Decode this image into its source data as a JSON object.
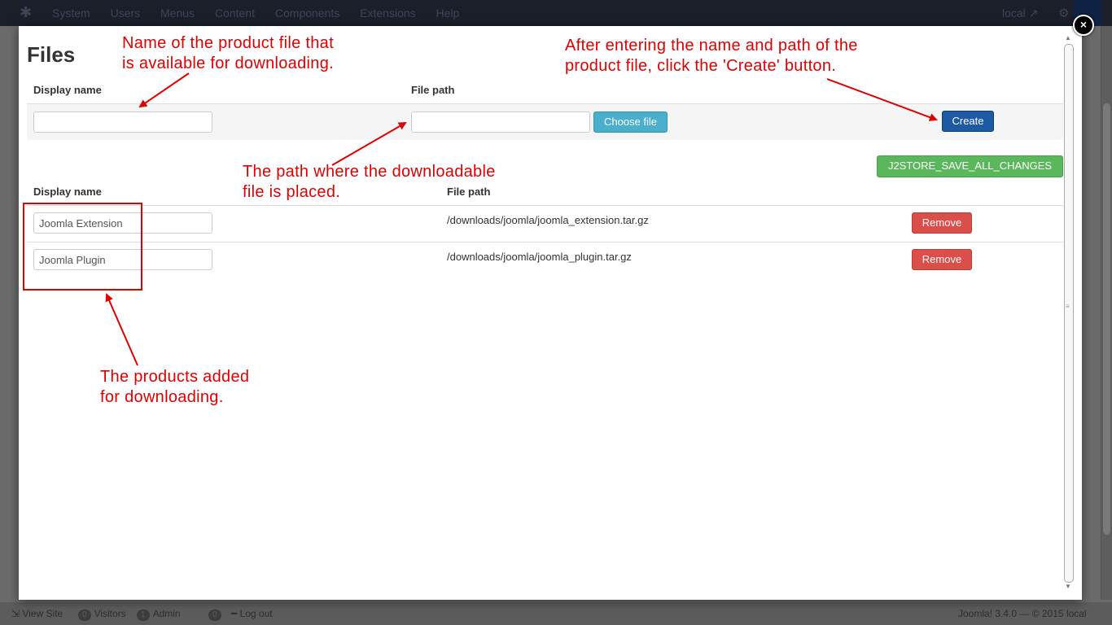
{
  "topbar": {
    "menu": [
      "System",
      "Users",
      "Menus",
      "Content",
      "Components",
      "Extensions",
      "Help"
    ],
    "site": "local"
  },
  "footer": {
    "view_site": "View Site",
    "visitors_count": "0",
    "visitors_label": "Visitors",
    "admin_count": "1",
    "admin_label": "Admin",
    "messages_count": "0",
    "logout": "Log out",
    "version": "Joomla! 3.4.0 — © 2015 local"
  },
  "modal": {
    "close_glyph": "×",
    "title": "Files",
    "new_file": {
      "display_name_header": "Display name",
      "file_path_header": "File path",
      "display_name_value": "",
      "file_path_value": "",
      "choose_file_label": "Choose file",
      "create_label": "Create"
    },
    "save_all_label": "J2STORE_SAVE_ALL_CHANGES",
    "files_table": {
      "headers": [
        "Display name",
        "File path"
      ],
      "rows": [
        {
          "display_name": "Joomla Extension",
          "file_path": "/downloads/joomla/joomla_extension.tar.gz",
          "remove_label": "Remove"
        },
        {
          "display_name": "Joomla Plugin",
          "file_path": "/downloads/joomla/joomla_plugin.tar.gz",
          "remove_label": "Remove"
        }
      ]
    }
  },
  "annotations": {
    "name_note": [
      "Name of the product file that",
      "is available for downloading."
    ],
    "create_note": [
      "After entering the name and path of the",
      "product file, click the 'Create' button."
    ],
    "path_note": [
      "The path where the downloadable",
      "file is placed."
    ],
    "products_note": [
      "The products added",
      "for downloading."
    ],
    "color": "#e00000"
  },
  "colors": {
    "primary": "#1c5ba3",
    "info": "#49afcd",
    "success": "#5bb75b",
    "danger": "#da4f49"
  }
}
